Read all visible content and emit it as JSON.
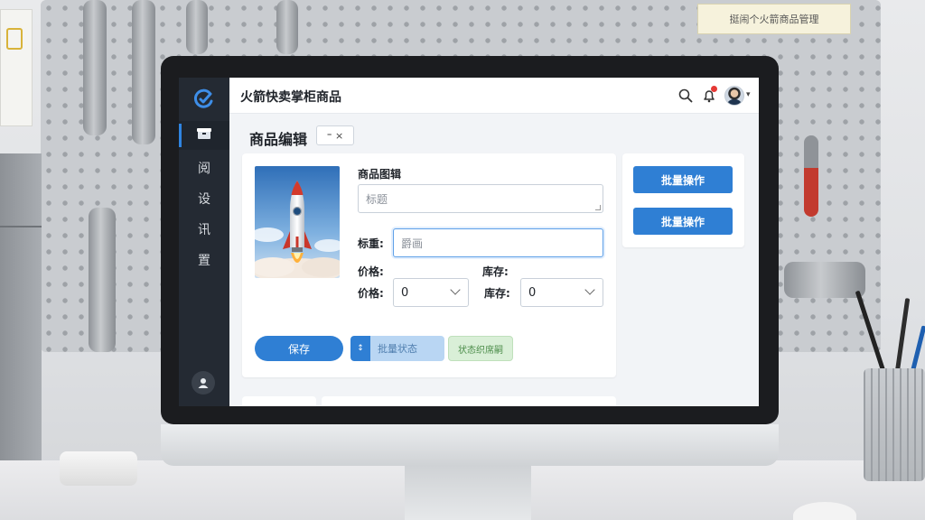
{
  "wall_note": "挺闹个火箭商品管理",
  "app": {
    "title": "火箭快卖掌柜商品"
  },
  "sidebar": {
    "items": [
      {
        "label": "",
        "icon": "box-icon"
      },
      {
        "label": "阅"
      },
      {
        "label": "设"
      },
      {
        "label": "讯"
      },
      {
        "label": "置"
      }
    ]
  },
  "header": {
    "icons": [
      "search-icon",
      "bell-icon",
      "avatar",
      "chevron-down-icon"
    ]
  },
  "page": {
    "title": "商品编辑",
    "tag": "⁼ ×"
  },
  "form": {
    "section_label": "商品图辑",
    "title_placeholder": "标题",
    "label_field_label": "标重:",
    "label_field_placeholder": "爵画",
    "price_header": "价格:",
    "stock_header": "库存:",
    "price_label": "价格:",
    "price_value": "0",
    "stock_label": "库存:",
    "stock_value": "0"
  },
  "actions": {
    "save": "保存",
    "batch_status": "批量状态",
    "batch_status_icon": "↕",
    "status_tag": "状态织席嗣"
  },
  "side_panel": {
    "batch_1": "批量操作",
    "batch_2": "批量操作"
  },
  "colors": {
    "accent": "#2f7fd4",
    "sidebar": "#242a33",
    "status_green": "#d9efd7"
  }
}
